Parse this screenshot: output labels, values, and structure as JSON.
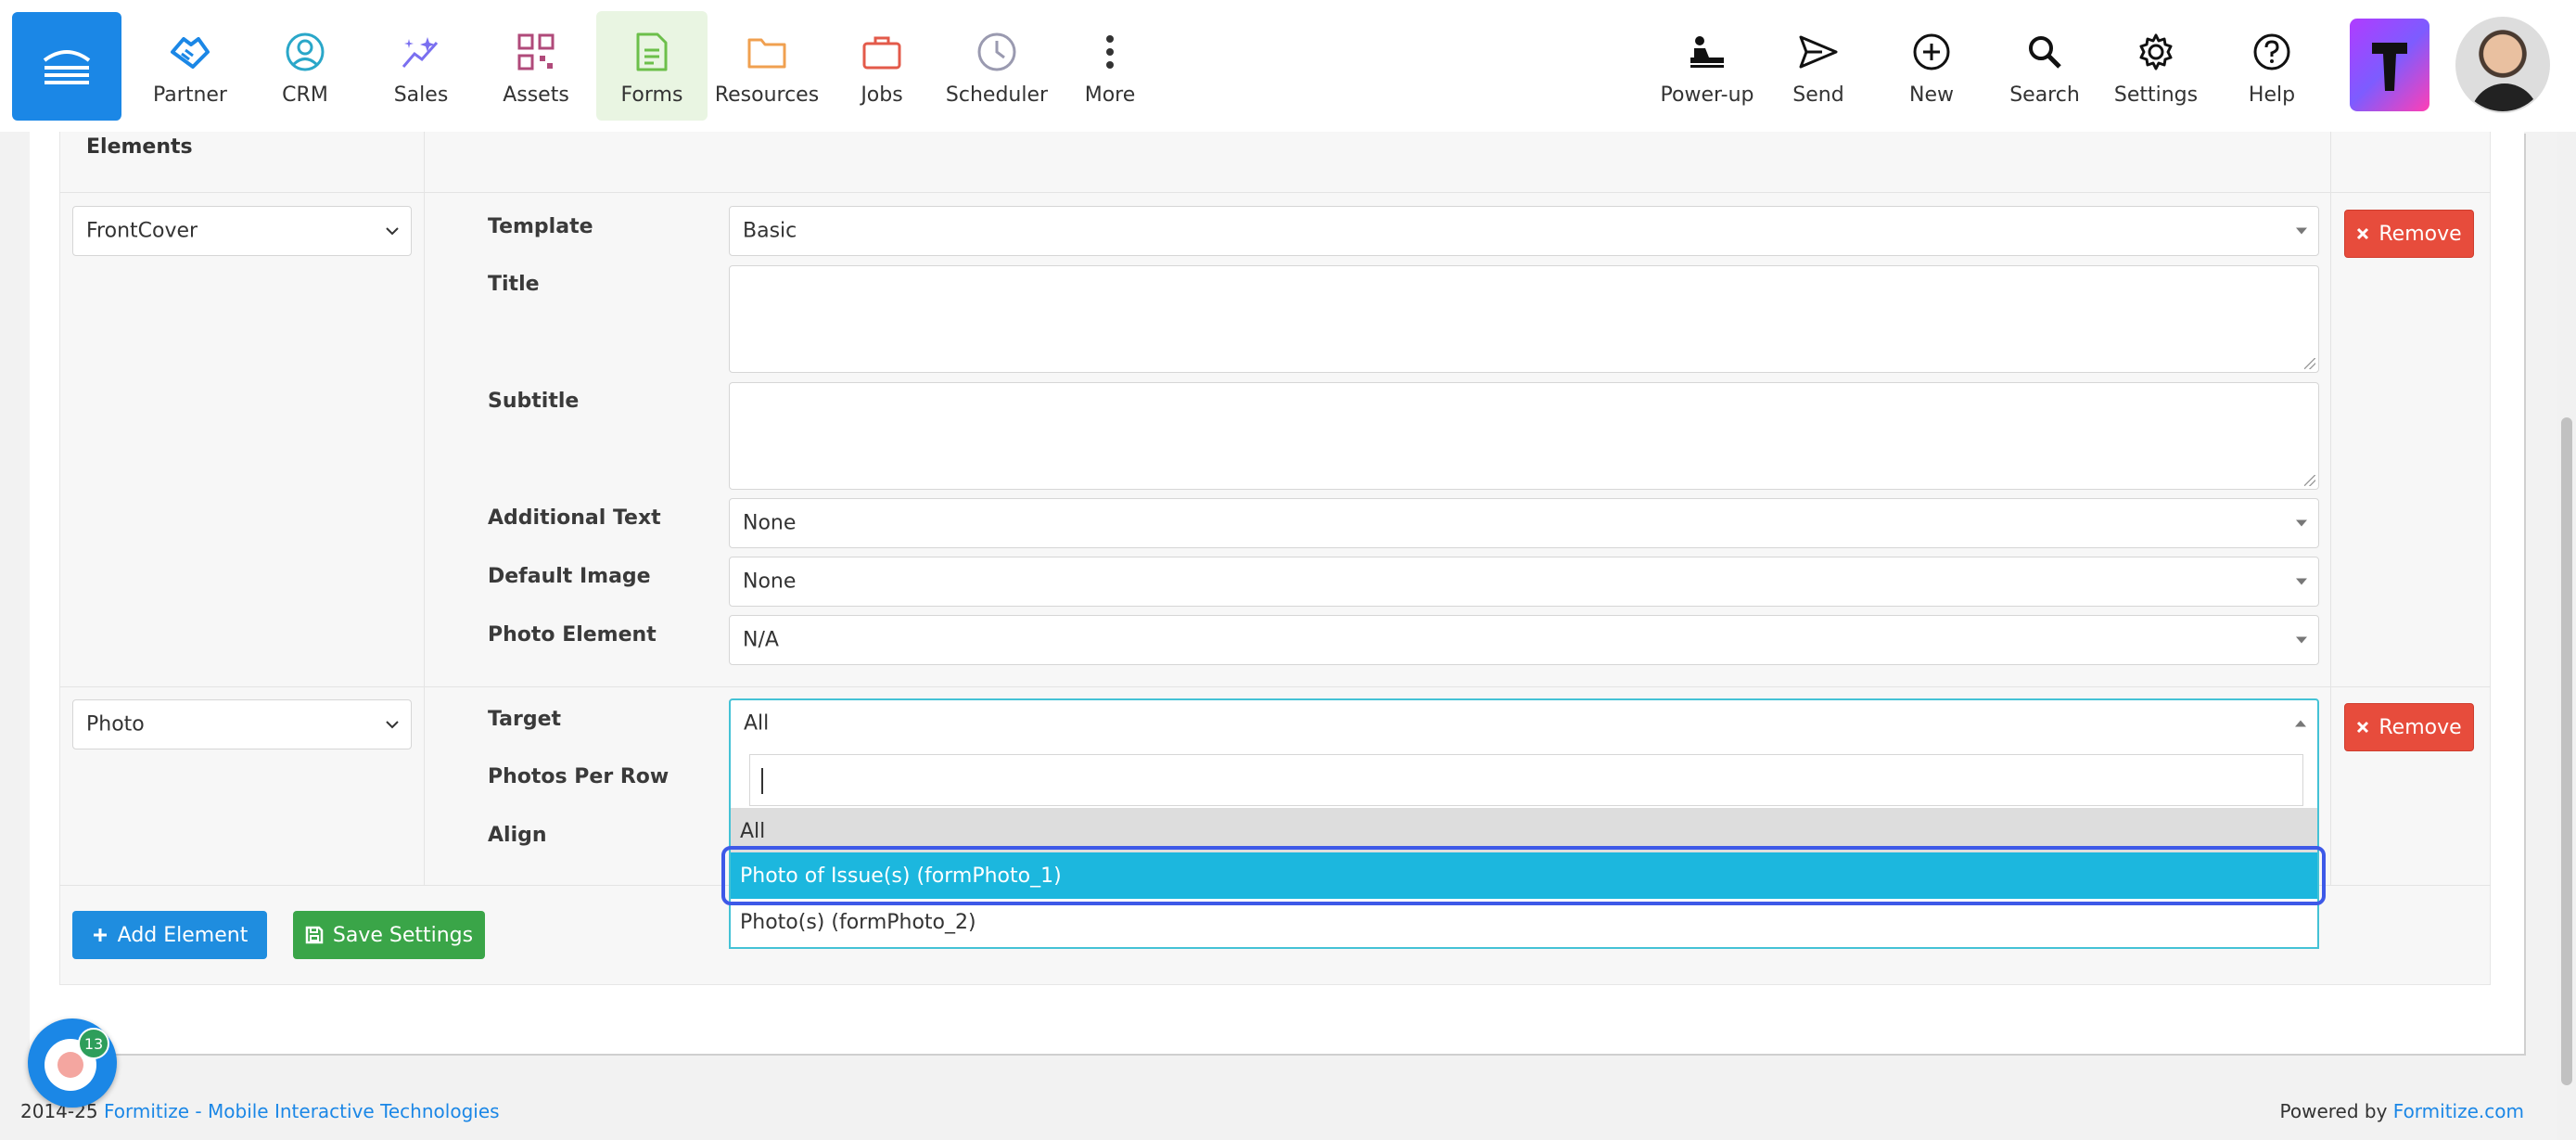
{
  "nav": {
    "items": [
      {
        "label": "Partner",
        "icon": "handshake-icon",
        "color": "#1b87e6"
      },
      {
        "label": "CRM",
        "icon": "person-circle-icon",
        "color": "#2aa7c9"
      },
      {
        "label": "Sales",
        "icon": "sparkle-chart-icon",
        "color": "#7a6ff0"
      },
      {
        "label": "Assets",
        "icon": "qr-code-icon",
        "color": "#b04a7a"
      },
      {
        "label": "Forms",
        "icon": "document-icon",
        "color": "#6cbf4a"
      },
      {
        "label": "Resources",
        "icon": "folder-icon",
        "color": "#f0a050"
      },
      {
        "label": "Jobs",
        "icon": "briefcase-icon",
        "color": "#e35a4a"
      },
      {
        "label": "Scheduler",
        "icon": "clock-icon",
        "color": "#9a9ab0"
      },
      {
        "label": "More",
        "icon": "dots-vertical-icon",
        "color": "#333333"
      }
    ],
    "right_items": [
      {
        "label": "Power-up",
        "icon": "power-up-icon"
      },
      {
        "label": "Send",
        "icon": "send-icon"
      },
      {
        "label": "New",
        "icon": "plus-circle-icon"
      },
      {
        "label": "Search",
        "icon": "search-icon"
      },
      {
        "label": "Settings",
        "icon": "gear-icon"
      },
      {
        "label": "Help",
        "icon": "help-circle-icon"
      }
    ],
    "active": "Forms"
  },
  "panel": {
    "heading": "Elements",
    "element1": {
      "type": "FrontCover",
      "fields": {
        "template_label": "Template",
        "template_value": "Basic",
        "title_label": "Title",
        "subtitle_label": "Subtitle",
        "additional_text_label": "Additional Text",
        "additional_text_value": "None",
        "default_image_label": "Default Image",
        "default_image_value": "None",
        "photo_element_label": "Photo Element",
        "photo_element_value": "N/A"
      },
      "remove_label": "Remove"
    },
    "element2": {
      "type": "Photo",
      "fields": {
        "target_label": "Target",
        "target_value": "All",
        "photos_per_row_label": "Photos Per Row",
        "align_label": "Align"
      },
      "remove_label": "Remove"
    },
    "dropdown": {
      "search_value": "",
      "options": [
        "All",
        "Photo of Issue(s) (formPhoto_1)",
        "Photo(s) (formPhoto_2)"
      ],
      "highlighted": "Photo of Issue(s) (formPhoto_1)"
    },
    "add_element_label": "Add Element",
    "save_settings_label": "Save Settings"
  },
  "footer": {
    "year": "2014-25",
    "company_link": "Formitize - Mobile Interactive Technologies",
    "powered_by": "Powered by",
    "powered_link": "Formitize.com"
  },
  "chat": {
    "badge": "13"
  },
  "colors": {
    "brand": "#1b87e6",
    "remove": "#e74c3c",
    "save": "#3aa548",
    "highlight": "#1cb7de"
  }
}
